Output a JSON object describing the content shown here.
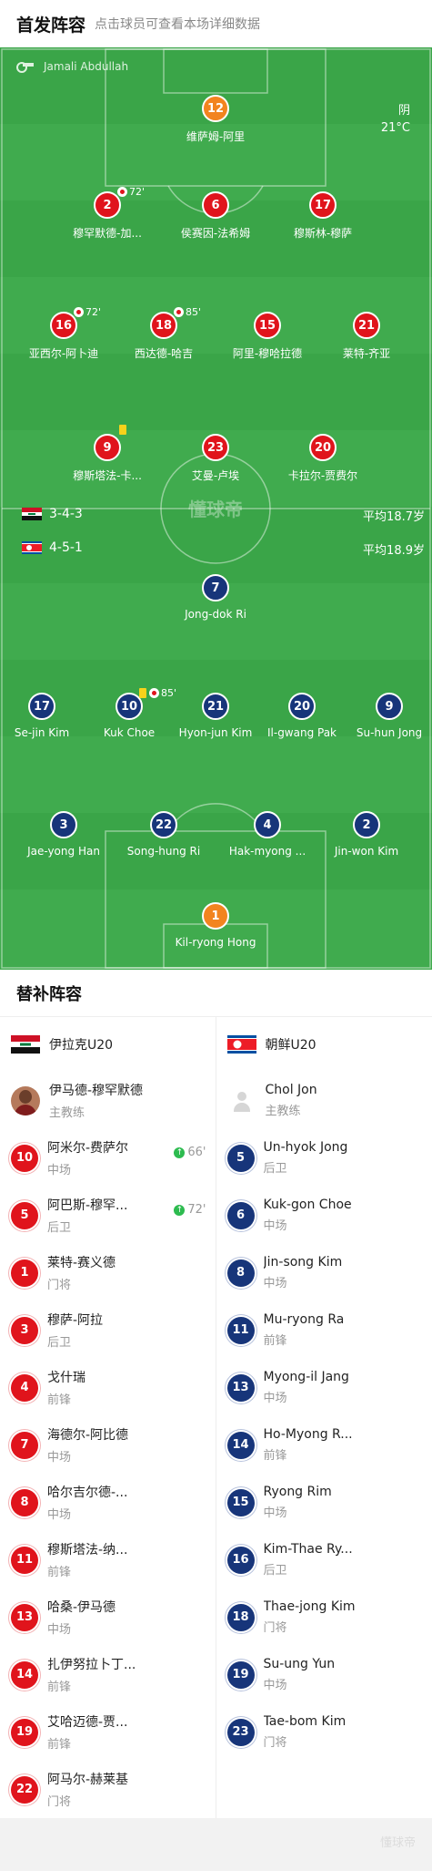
{
  "header": {
    "title": "首发阵容",
    "hint": "点击球员可查看本场详细数据"
  },
  "pitch": {
    "referee": "Jamali Abdullah",
    "weather": {
      "condition": "阴",
      "temperature": "21°C"
    },
    "watermark": "懂球帝",
    "home": {
      "formation": "3-4-3",
      "avg_age": "平均18.7岁"
    },
    "away": {
      "formation": "4-5-1",
      "avg_age": "平均18.9岁"
    },
    "home_players": [
      {
        "number": "12",
        "name": "维萨姆-阿里"
      },
      {
        "number": "2",
        "name": "穆罕默德-加...",
        "event": "72'"
      },
      {
        "number": "6",
        "name": "侯赛因-法希姆"
      },
      {
        "number": "17",
        "name": "穆斯林-穆萨"
      },
      {
        "number": "16",
        "name": "亚西尔-阿卜迪",
        "event": "72'"
      },
      {
        "number": "18",
        "name": "西达德-哈吉",
        "event": "85'"
      },
      {
        "number": "15",
        "name": "阿里-穆哈拉德"
      },
      {
        "number": "21",
        "name": "莱特-齐亚"
      },
      {
        "number": "9",
        "name": "穆斯塔法-卡..."
      },
      {
        "number": "23",
        "name": "艾曼-卢埃"
      },
      {
        "number": "20",
        "name": "卡拉尔-贾费尔"
      }
    ],
    "away_players": [
      {
        "number": "7",
        "name": "Jong-dok Ri"
      },
      {
        "number": "17",
        "name": "Se-jin Kim"
      },
      {
        "number": "10",
        "name": "Kuk Choe",
        "event": "85'"
      },
      {
        "number": "21",
        "name": "Hyon-jun Kim"
      },
      {
        "number": "20",
        "name": "Il-gwang Pak"
      },
      {
        "number": "9",
        "name": "Su-hun Jong"
      },
      {
        "number": "3",
        "name": "Jae-yong Han"
      },
      {
        "number": "22",
        "name": "Song-hung Ri"
      },
      {
        "number": "4",
        "name": "Hak-myong ..."
      },
      {
        "number": "2",
        "name": "Jin-won Kim"
      },
      {
        "number": "1",
        "name": "Kil-ryong Hong"
      }
    ]
  },
  "subs": {
    "title": "替补阵容",
    "home": {
      "team": "伊拉克U20",
      "coach": {
        "name": "伊马德-穆罕默德",
        "role": "主教练"
      },
      "players": [
        {
          "number": "10",
          "name": "阿米尔-费萨尔",
          "pos": "中场",
          "time": "66'"
        },
        {
          "number": "5",
          "name": "阿巴斯-穆罕...",
          "pos": "后卫",
          "time": "72'"
        },
        {
          "number": "1",
          "name": "莱特-赛义德",
          "pos": "门将"
        },
        {
          "number": "3",
          "name": "穆萨-阿拉",
          "pos": "后卫"
        },
        {
          "number": "4",
          "name": "戈什瑞",
          "pos": "前锋"
        },
        {
          "number": "7",
          "name": "海德尔-阿比德",
          "pos": "中场"
        },
        {
          "number": "8",
          "name": "哈尔吉尔德-...",
          "pos": "中场"
        },
        {
          "number": "11",
          "name": "穆斯塔法-纳...",
          "pos": "前锋"
        },
        {
          "number": "13",
          "name": "哈桑-伊马德",
          "pos": "中场"
        },
        {
          "number": "14",
          "name": "扎伊努拉卜丁...",
          "pos": "前锋"
        },
        {
          "number": "19",
          "name": "艾哈迈德-贾...",
          "pos": "前锋"
        },
        {
          "number": "22",
          "name": "阿马尔-赫莱基",
          "pos": "门将"
        }
      ]
    },
    "away": {
      "team": "朝鲜U20",
      "coach": {
        "name": "Chol Jon",
        "role": "主教练"
      },
      "players": [
        {
          "number": "5",
          "name": "Un-hyok Jong",
          "pos": "后卫"
        },
        {
          "number": "6",
          "name": "Kuk-gon Choe",
          "pos": "中场"
        },
        {
          "number": "8",
          "name": "Jin-song Kim",
          "pos": "中场"
        },
        {
          "number": "11",
          "name": "Mu-ryong Ra",
          "pos": "前锋"
        },
        {
          "number": "13",
          "name": "Myong-il Jang",
          "pos": "中场"
        },
        {
          "number": "14",
          "name": "Ho-Myong R...",
          "pos": "前锋"
        },
        {
          "number": "15",
          "name": "Ryong Rim",
          "pos": "中场"
        },
        {
          "number": "16",
          "name": "Kim-Thae Ry...",
          "pos": "后卫"
        },
        {
          "number": "18",
          "name": "Thae-jong Kim",
          "pos": "门将"
        },
        {
          "number": "19",
          "name": "Su-ung Yun",
          "pos": "中场"
        },
        {
          "number": "23",
          "name": "Tae-bom Kim",
          "pos": "门将"
        }
      ]
    }
  },
  "footer": {
    "watermark": "懂球帝"
  },
  "colors": {
    "pitch": "#3aa548",
    "home": "#e0141c",
    "away": "#17357a",
    "goalkeeper_home": "#f2841f",
    "goalkeeper_away": "#f2841f"
  }
}
